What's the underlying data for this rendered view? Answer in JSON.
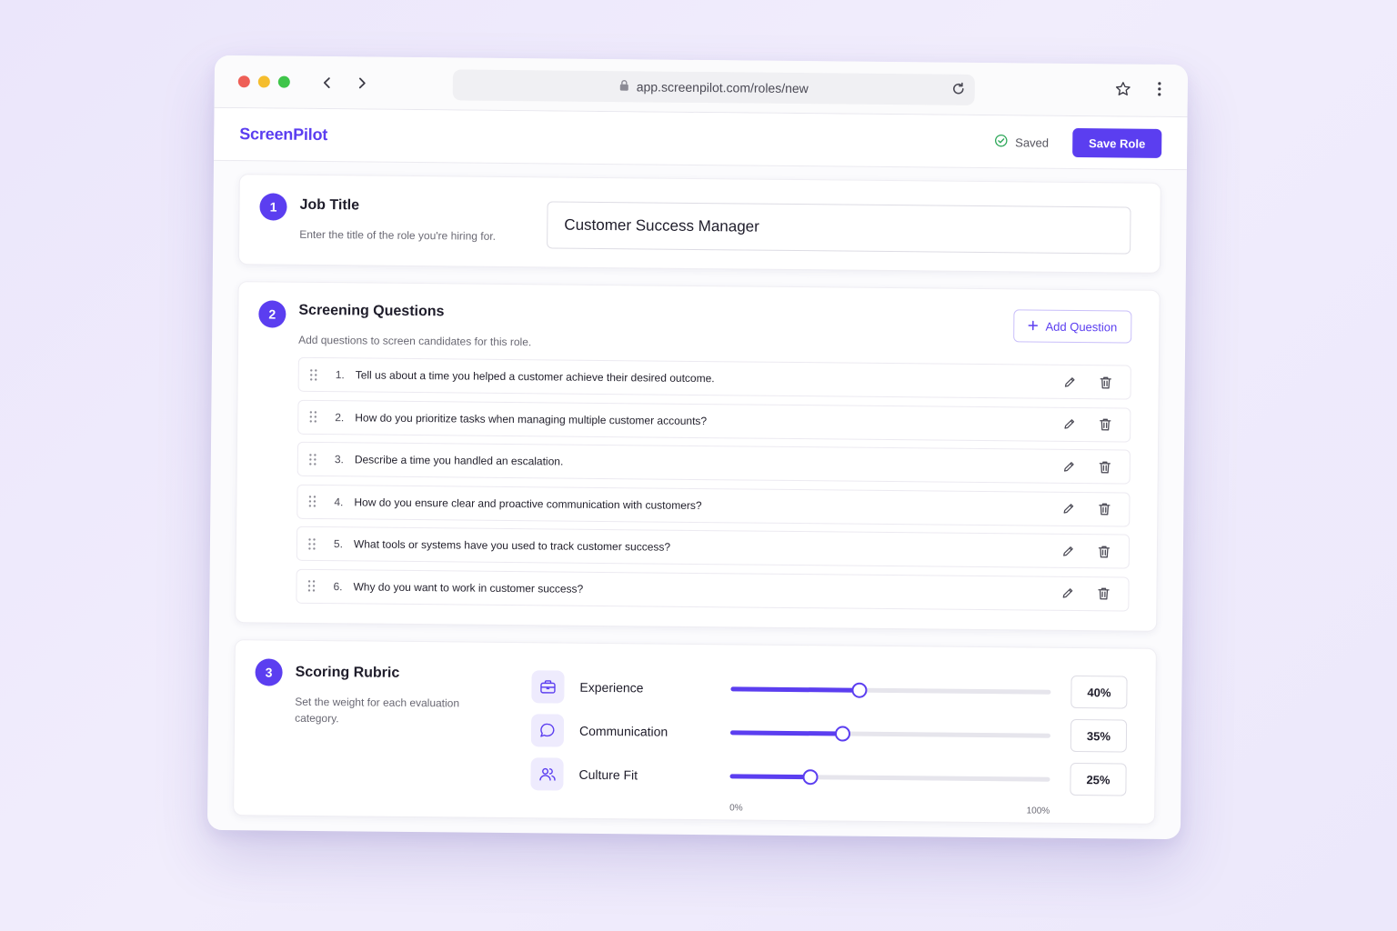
{
  "browser": {
    "url": "app.screenpilot.com/roles/new"
  },
  "app": {
    "brand": "ScreenPilot",
    "saved_status": "Saved",
    "save_button": "Save Role"
  },
  "job_title": {
    "step": "1",
    "title": "Job Title",
    "description": "Enter the title of the role you're hiring for.",
    "value": "Customer Success Manager"
  },
  "questions": {
    "step": "2",
    "title": "Screening Questions",
    "description": "Add questions to screen candidates for this role.",
    "add_button": "Add Question",
    "items": [
      {
        "num": "1.",
        "text": "Tell us about a time you helped a customer achieve their desired outcome."
      },
      {
        "num": "2.",
        "text": "How do you prioritize tasks when managing multiple customer accounts?"
      },
      {
        "num": "3.",
        "text": "Describe a time you handled an escalation."
      },
      {
        "num": "4.",
        "text": "How do you ensure clear and proactive communication with customers?"
      },
      {
        "num": "5.",
        "text": "What tools or systems have you used to track customer success?"
      },
      {
        "num": "6.",
        "text": "Why do you want to work in customer success?"
      }
    ]
  },
  "rubric": {
    "step": "3",
    "title": "Scoring Rubric",
    "description": "Set the weight for each evaluation category.",
    "scale_min": "0%",
    "scale_max": "100%",
    "items": [
      {
        "label": "Experience",
        "icon": "briefcase-icon",
        "weight": 40,
        "weight_label": "40%"
      },
      {
        "label": "Communication",
        "icon": "chat-bubble-icon",
        "weight": 35,
        "weight_label": "35%"
      },
      {
        "label": "Culture Fit",
        "icon": "users-icon",
        "weight": 25,
        "weight_label": "25%"
      }
    ]
  },
  "colors": {
    "accent": "#5b3ef0",
    "success": "#2fa85a"
  }
}
